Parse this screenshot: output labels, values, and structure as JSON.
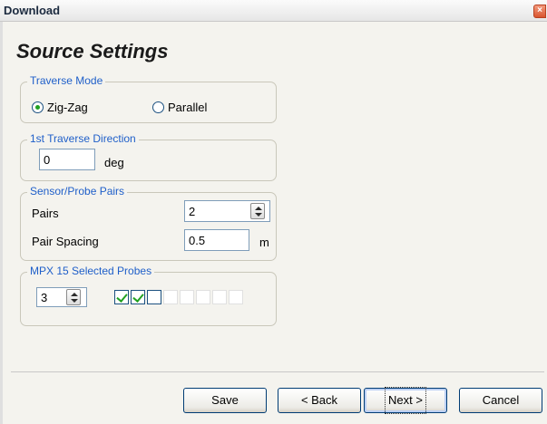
{
  "window": {
    "title": "Download"
  },
  "page": {
    "title": "Source Settings"
  },
  "traverse_mode": {
    "legend": "Traverse Mode",
    "options": [
      {
        "label": "Zig-Zag",
        "checked": true
      },
      {
        "label": "Parallel",
        "checked": false
      }
    ]
  },
  "traverse_direction": {
    "legend": "1st Traverse Direction",
    "value": "0",
    "unit": "deg"
  },
  "sensor_pairs": {
    "legend": "Sensor/Probe Pairs",
    "pairs_label": "Pairs",
    "pairs_value": "2",
    "spacing_label": "Pair Spacing",
    "spacing_value": "0.5",
    "spacing_unit": "m"
  },
  "probes": {
    "legend": "MPX 15 Selected Probes",
    "count_value": "3",
    "checkboxes": [
      {
        "checked": true,
        "enabled": true
      },
      {
        "checked": true,
        "enabled": true
      },
      {
        "checked": false,
        "enabled": true
      },
      {
        "checked": false,
        "enabled": false
      },
      {
        "checked": false,
        "enabled": false
      },
      {
        "checked": false,
        "enabled": false
      },
      {
        "checked": false,
        "enabled": false
      },
      {
        "checked": false,
        "enabled": false
      }
    ]
  },
  "buttons": {
    "save": "Save",
    "back": "< Back",
    "next": "Next >",
    "cancel": "Cancel"
  },
  "colors": {
    "legend_text": "#1f5fc9",
    "check_mark": "#21a121",
    "close_button": "#d9542e"
  }
}
